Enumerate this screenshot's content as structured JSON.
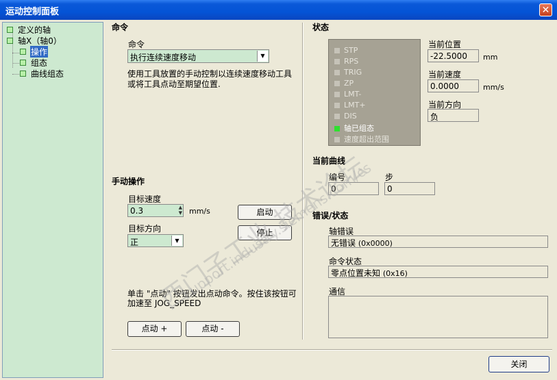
{
  "window": {
    "title": "运动控制面板",
    "close_glyph": "✕"
  },
  "tree": {
    "items": [
      {
        "label": "定义的轴"
      },
      {
        "label": "轴X（轴0）"
      },
      {
        "label": "操作"
      },
      {
        "label": "组态"
      },
      {
        "label": "曲线组态"
      }
    ]
  },
  "command": {
    "heading": "命令",
    "label": "命令",
    "selected": "执行连续速度移动",
    "description_line1": "使用工具放置的手动控制以连续速度移动工具",
    "description_line2": "或将工具点动至期望位置."
  },
  "manual": {
    "heading": "手动操作",
    "target_speed_label": "目标速度",
    "target_speed_value": "0.3",
    "target_speed_unit": "mm/s",
    "start_button": "启动",
    "target_dir_label": "目标方向",
    "target_dir_value": "正",
    "stop_button": "停止",
    "jog_text_line1": "单击 \"点动\" 按钮发出点动命令。按住该按钮可",
    "jog_text_line2": "加速至 JOG_SPEED",
    "jog_plus_button": "点动 +",
    "jog_minus_button": "点动 -"
  },
  "status": {
    "heading": "状态",
    "flags": [
      {
        "label": "STP",
        "on": false
      },
      {
        "label": "RPS",
        "on": false
      },
      {
        "label": "TRIG",
        "on": false
      },
      {
        "label": "ZP",
        "on": false
      },
      {
        "label": "LMT-",
        "on": false
      },
      {
        "label": "LMT+",
        "on": false
      },
      {
        "label": "DIS",
        "on": false
      },
      {
        "label": "轴已组态",
        "on": true
      },
      {
        "label": "速度超出范围",
        "on": false
      }
    ],
    "position_label": "当前位置",
    "position_value": "-22.5000",
    "position_unit": "mm",
    "speed_label": "当前速度",
    "speed_value": "0.0000",
    "speed_unit": "mm/s",
    "direction_label": "当前方向",
    "direction_value": "负"
  },
  "profile": {
    "heading": "当前曲线",
    "number_label": "编号",
    "number_value": "0",
    "step_label": "步",
    "step_value": "0"
  },
  "errors": {
    "heading": "错误/状态",
    "axis_error_label": "轴错误",
    "axis_error_value": "无错误",
    "axis_error_code": "(0x0000)",
    "cmd_status_label": "命令状态",
    "cmd_status_value": "零点位置未知",
    "cmd_status_code": "(0x16)",
    "comm_label": "通信",
    "comm_value": ""
  },
  "footer": {
    "close_button": "关闭"
  },
  "watermark": {
    "line1": "西门子工业  技术论坛",
    "line2": "support.industry.siemens.com/cs"
  }
}
